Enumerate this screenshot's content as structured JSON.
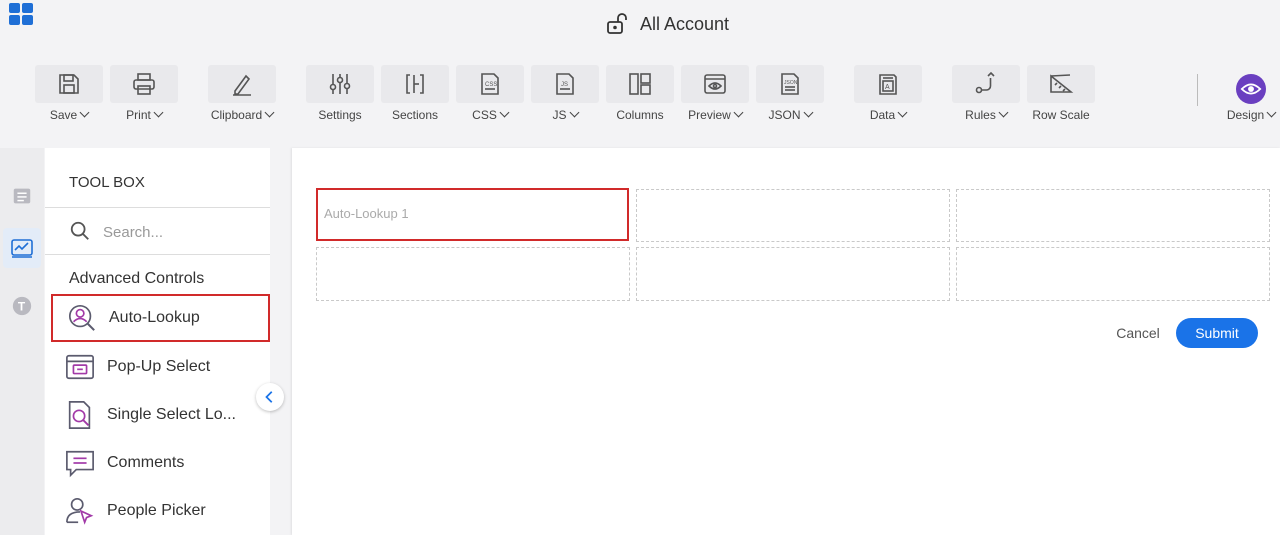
{
  "header": {
    "title": "All Account"
  },
  "toolbar": {
    "items": [
      {
        "label": "Save",
        "icon": "save-icon",
        "dropdown": true
      },
      {
        "label": "Print",
        "icon": "print-icon",
        "dropdown": true
      },
      {
        "label": "Clipboard",
        "icon": "clipboard-icon",
        "dropdown": true
      },
      {
        "label": "Settings",
        "icon": "settings-icon",
        "dropdown": false
      },
      {
        "label": "Sections",
        "icon": "sections-icon",
        "dropdown": false
      },
      {
        "label": "CSS",
        "icon": "css-icon",
        "dropdown": true
      },
      {
        "label": "JS",
        "icon": "js-icon",
        "dropdown": true
      },
      {
        "label": "Columns",
        "icon": "columns-icon",
        "dropdown": false
      },
      {
        "label": "Preview",
        "icon": "preview-icon",
        "dropdown": true
      },
      {
        "label": "JSON",
        "icon": "json-icon",
        "dropdown": true
      },
      {
        "label": "Data",
        "icon": "data-icon",
        "dropdown": true
      },
      {
        "label": "Rules",
        "icon": "rules-icon",
        "dropdown": true
      },
      {
        "label": "Row Scale",
        "icon": "row-scale-icon",
        "dropdown": false
      }
    ],
    "design_label": "Design"
  },
  "toolbox": {
    "title": "TOOL BOX",
    "search_placeholder": "Search...",
    "section_title": "Advanced Controls",
    "items": [
      {
        "label": "Auto-Lookup",
        "icon": "auto-lookup-icon",
        "selected": true
      },
      {
        "label": "Pop-Up Select",
        "icon": "popup-select-icon",
        "selected": false
      },
      {
        "label": "Single Select Lo...",
        "icon": "single-select-lookup-icon",
        "selected": false
      },
      {
        "label": "Comments",
        "icon": "comments-icon",
        "selected": false
      },
      {
        "label": "People Picker",
        "icon": "people-picker-icon",
        "selected": false
      }
    ]
  },
  "canvas": {
    "cells": [
      {
        "text": "Auto-Lookup 1",
        "selected": true
      },
      {
        "text": "",
        "selected": false
      },
      {
        "text": "",
        "selected": false
      },
      {
        "text": "",
        "selected": false
      },
      {
        "text": "",
        "selected": false
      },
      {
        "text": "",
        "selected": false
      }
    ],
    "cancel_label": "Cancel",
    "submit_label": "Submit"
  },
  "colors": {
    "accent": "#1a73e8",
    "selection": "#d12a2a",
    "design": "#6a3fc0"
  }
}
